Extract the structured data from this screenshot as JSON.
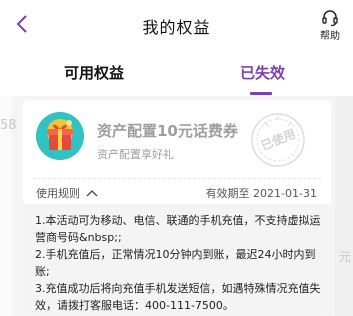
{
  "header": {
    "title": "我的权益",
    "help_label": "帮助"
  },
  "tabs": [
    {
      "label": "可用权益",
      "active": false
    },
    {
      "label": "已失效",
      "active": true
    }
  ],
  "accent_color": "#7b3fb5",
  "background_peek": {
    "left_number": "58",
    "right_text": "元"
  },
  "coupon": {
    "name": "资产配置10元话费券",
    "subtitle": "资产配置享好礼",
    "stamp": "已使用",
    "rules_label": "使用规则",
    "expiry": "有效期至 2021-01-31"
  },
  "rules": [
    "1.本活动可为移动、电信、联通的手机充值，不支持虚拟运营商号码&nbsp;;",
    "2.手机充值后，正常情况10分钟内到账，最迟24小时内到账;",
    "3.充值成功后将向充值手机发送短信，如遇特殊情况充值失效，请拨打客服电话：400-111-7500。"
  ]
}
